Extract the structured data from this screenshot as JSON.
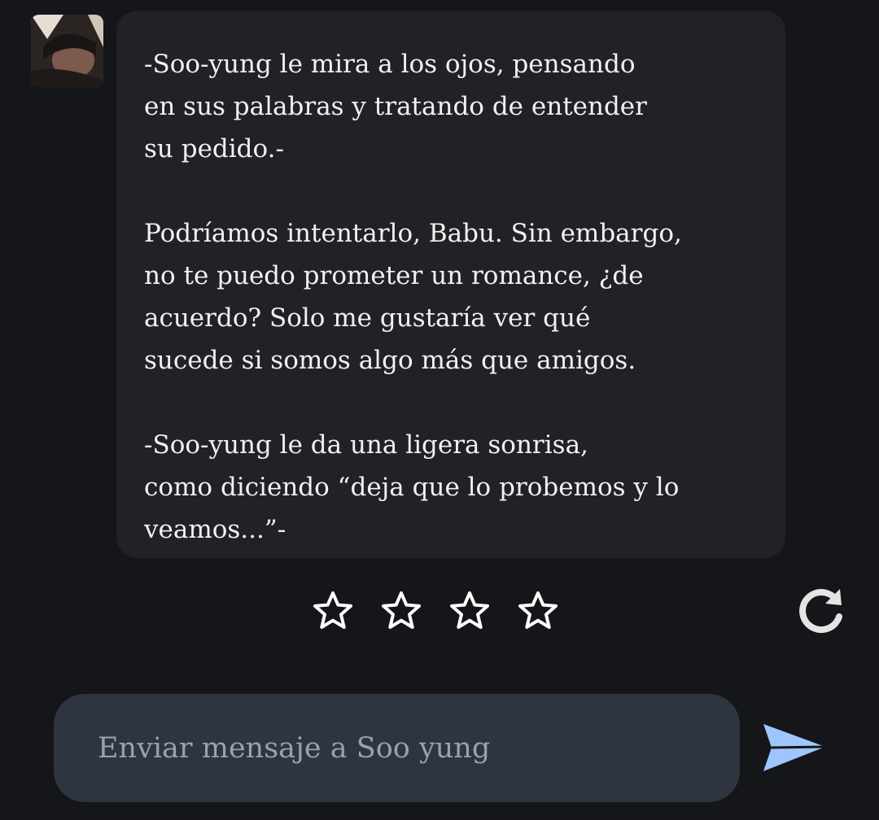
{
  "message": {
    "paragraphs": [
      "-Soo-yung le mira a los ojos, pensando\nen sus palabras y tratando de entender\nsu pedido.-",
      "Podríamos intentarlo, Babu. Sin embargo,\nno te puedo prometer un romance, ¿de\nacuerdo? Solo me gustaría ver qué\nsucede si somos algo más que amigos.",
      "-Soo-yung le da una ligera sonrisa,\ncomo diciendo “deja que lo probemos y lo\nveamos...”-"
    ]
  },
  "rating": {
    "max_stars": 4,
    "selected": 0,
    "icon": "star-outline-icon"
  },
  "regenerate": {
    "icon": "refresh-icon"
  },
  "composer": {
    "placeholder": "Enviar mensaje a Soo yung",
    "value": ""
  },
  "send": {
    "icon": "send-icon",
    "color": "#9fc5ff"
  },
  "colors": {
    "background": "#151619",
    "bubble": "#202226",
    "composer": "#2f3540",
    "text": "#f1f1f1"
  }
}
